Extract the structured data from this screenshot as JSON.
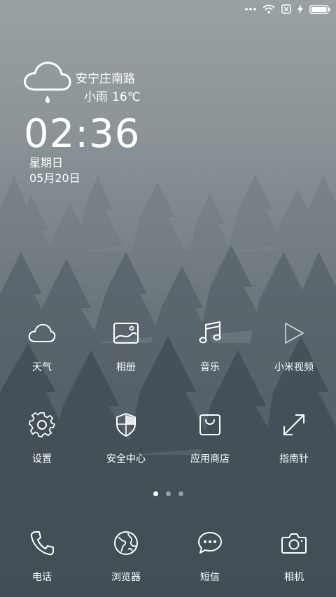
{
  "weather": {
    "location": "安宁庄南路",
    "condition": "小雨",
    "temperature": "16℃"
  },
  "clock": {
    "time": "02:36",
    "weekday": "星期日",
    "date": "05月20日"
  },
  "apps": {
    "row1": [
      {
        "label": "天气",
        "icon": "cloud-icon"
      },
      {
        "label": "相册",
        "icon": "photo-icon"
      },
      {
        "label": "音乐",
        "icon": "music-note-icon"
      },
      {
        "label": "小米视频",
        "icon": "play-icon"
      }
    ],
    "row2": [
      {
        "label": "设置",
        "icon": "gear-icon"
      },
      {
        "label": "安全中心",
        "icon": "shield-icon"
      },
      {
        "label": "应用商店",
        "icon": "shopping-bag-icon"
      },
      {
        "label": "指南针",
        "icon": "expand-arrows-icon"
      }
    ]
  },
  "pager": {
    "pages": 3,
    "current": 1
  },
  "dock": [
    {
      "label": "电话",
      "icon": "phone-icon"
    },
    {
      "label": "浏览器",
      "icon": "globe-icon"
    },
    {
      "label": "短信",
      "icon": "chat-bubble-icon"
    },
    {
      "label": "相机",
      "icon": "camera-icon"
    }
  ]
}
